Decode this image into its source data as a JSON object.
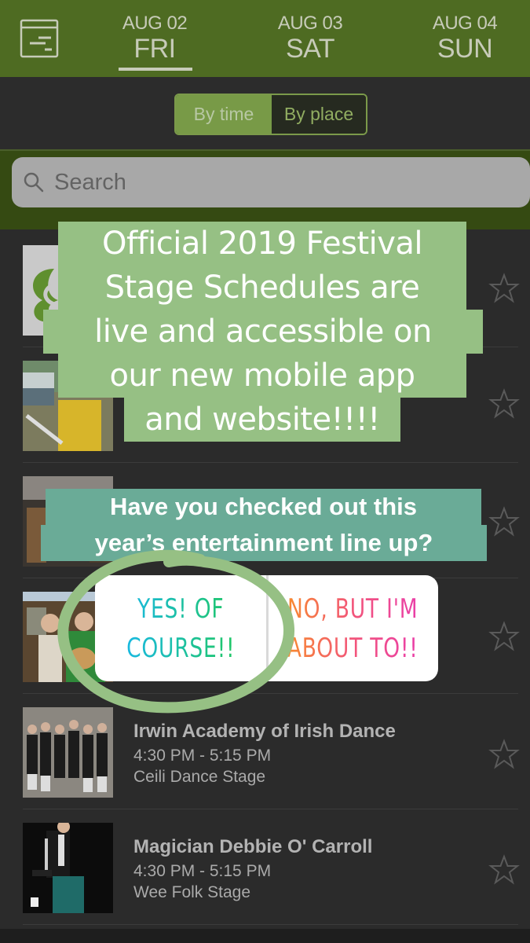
{
  "header": {
    "menu_icon": "schedule-list-icon",
    "days": [
      {
        "date": "AUG 02",
        "dow": "FRI",
        "selected": true
      },
      {
        "date": "AUG 03",
        "dow": "SAT",
        "selected": false
      },
      {
        "date": "AUG 04",
        "dow": "SUN",
        "selected": false
      }
    ]
  },
  "segment": {
    "options": [
      "By time",
      "By place"
    ],
    "selected": "By time"
  },
  "search": {
    "placeholder": "Search",
    "icon": "search-icon"
  },
  "events": [
    {
      "title": "",
      "time": "",
      "stage": "",
      "thumb": "festival-logo",
      "starred": false
    },
    {
      "title": "",
      "time": "",
      "stage": "",
      "thumb": "hurling-player-photo",
      "starred": false
    },
    {
      "title": "",
      "time": "",
      "stage": "",
      "thumb": "stage-interior-photo",
      "starred": false
    },
    {
      "title": "",
      "time": "",
      "stage": "",
      "thumb": "guitar-musicians-photo",
      "starred": false
    },
    {
      "title": "Irwin Academy of Irish Dance",
      "time": "4:30 PM - 5:15 PM",
      "stage": "Ceili Dance Stage",
      "thumb": "irish-dancers-photo",
      "starred": false
    },
    {
      "title": "Magician Debbie O' Carroll",
      "time": "4:30 PM - 5:15 PM",
      "stage": "Wee Folk Stage",
      "thumb": "magician-photo",
      "starred": false
    }
  ],
  "overlay": {
    "announcement_lines": [
      "Official 2019 Festival",
      "Stage Schedules are",
      "live and accessible on",
      "our new mobile app",
      "and website!!!!"
    ],
    "question_lines": [
      "Have you checked out this",
      "year’s entertainment line up?"
    ],
    "poll": {
      "option_yes_line1": "YES! OF",
      "option_yes_line2": "COURSE!!",
      "option_no_line1": "NO, BUT I'M",
      "option_no_line2": "ABOUT TO!!"
    },
    "colors": {
      "announcement_bg": "#96c084",
      "question_bg": "#6aab97",
      "circle": "#96c084"
    }
  },
  "colors": {
    "header_bg": "#4e6b22",
    "search_band_bg": "#354a12",
    "list_bg": "#2b2b2b",
    "accent": "#789a47"
  }
}
